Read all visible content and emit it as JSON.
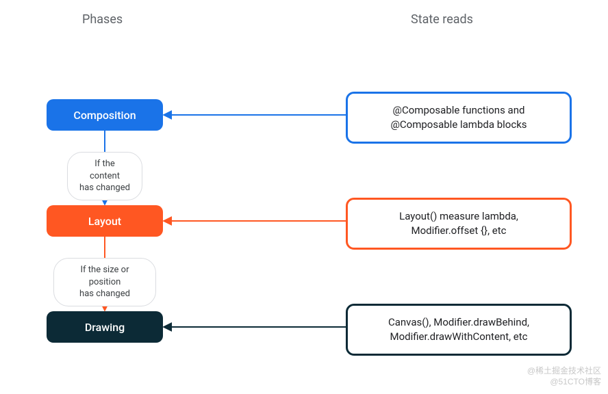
{
  "headers": {
    "phases": "Phases",
    "state_reads": "State reads"
  },
  "phases": {
    "composition": {
      "label": "Composition",
      "color": "#1a73e8"
    },
    "layout": {
      "label": "Layout",
      "color": "#ff5722"
    },
    "drawing": {
      "label": "Drawing",
      "color": "#0c2a36"
    }
  },
  "transitions": {
    "content_changed": "If the content\nhas changed",
    "size_changed": "If the size or position\nhas changed"
  },
  "state_reads": {
    "composition": "@Composable functions and\n@Composable lambda blocks",
    "layout": "Layout() measure lambda,\nModifier.offset {}, etc",
    "drawing": "Canvas(), Modifier.drawBehind,\nModifier.drawWithContent, etc"
  },
  "watermarks": {
    "line1": "@稀土掘金技术社区",
    "line2": "@51CTO博客"
  },
  "colors": {
    "blue": "#1a73e8",
    "orange": "#ff5722",
    "dark": "#0c2a36"
  }
}
